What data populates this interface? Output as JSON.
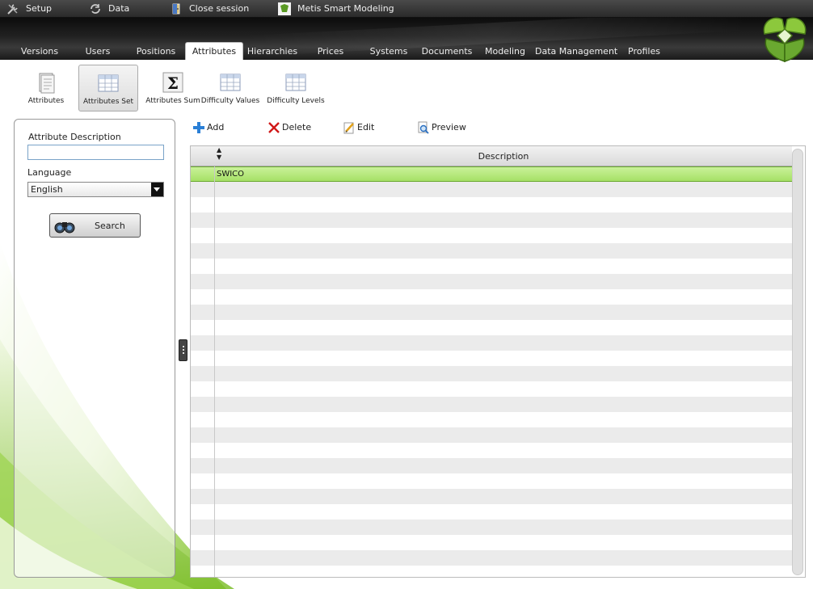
{
  "menubar": {
    "items": [
      {
        "label": "Setup",
        "icon": "tools-icon"
      },
      {
        "label": "Data",
        "icon": "refresh-icon"
      },
      {
        "label": "Close session",
        "icon": "door-icon"
      },
      {
        "label": "Metis Smart Modeling",
        "icon": "app-logo-icon"
      }
    ]
  },
  "tabs": [
    {
      "label": "Versions"
    },
    {
      "label": "Users"
    },
    {
      "label": "Positions"
    },
    {
      "label": "Attributes",
      "active": true
    },
    {
      "label": "Hierarchies"
    },
    {
      "label": "Prices"
    },
    {
      "label": "Systems"
    },
    {
      "label": "Documents"
    },
    {
      "label": "Modeling"
    },
    {
      "label": "Data Management"
    },
    {
      "label": "Profiles"
    }
  ],
  "subtoolbar": {
    "items": [
      {
        "label": "Attributes",
        "icon": "document-icon"
      },
      {
        "label": "Attributes Set",
        "icon": "table-icon",
        "selected": true
      },
      {
        "label": "Attributes Sum",
        "icon": "sigma-icon"
      },
      {
        "label": "Difficulty Values",
        "icon": "table-icon"
      },
      {
        "label": "Difficulty Levels",
        "icon": "table-icon"
      }
    ]
  },
  "filter": {
    "description_label": "Attribute Description",
    "description_value": "",
    "language_label": "Language",
    "language_value": "English",
    "search_label": "Search"
  },
  "actions": {
    "add": "Add",
    "delete": "Delete",
    "edit": "Edit",
    "preview": "Preview"
  },
  "grid": {
    "columns": [
      "Description"
    ],
    "rows": [
      {
        "description": "SWICO",
        "selected": true
      }
    ],
    "empty_rows": 26
  },
  "colors": {
    "selected_row": "#b4e87a",
    "menubar": "#333333",
    "brand_green": "#6aa830"
  }
}
